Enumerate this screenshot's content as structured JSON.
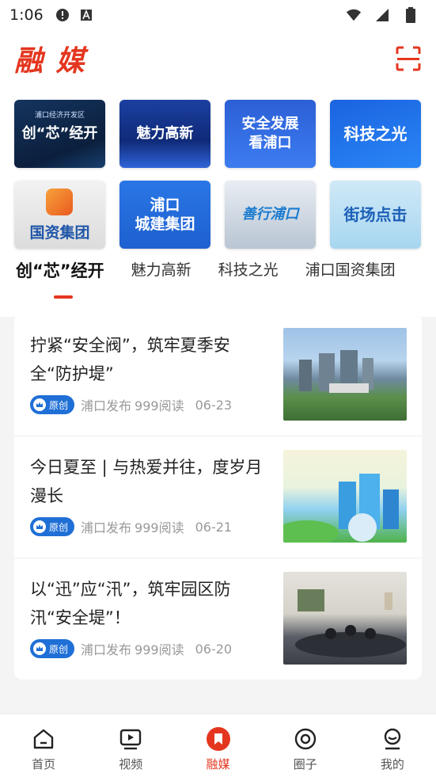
{
  "status_bar": {
    "time": "1:06",
    "icons": [
      "alert-icon",
      "a-badge-icon",
      "wifi-icon",
      "signal-icon",
      "battery-icon"
    ]
  },
  "header": {
    "title": "融 媒",
    "scan_icon": "scan-icon",
    "accent_color": "#e4361f"
  },
  "tiles": [
    {
      "label": "创“芯”经开",
      "sub": "浦口经济开发区"
    },
    {
      "label": "魅力高新",
      "sub": ""
    },
    {
      "label": "安全发展\n看浦口",
      "sub": ""
    },
    {
      "label": "科技之光",
      "sub": ""
    },
    {
      "label": "国资集团",
      "sub": ""
    },
    {
      "label": "浦口\n城建集团",
      "sub": ""
    },
    {
      "label": "善行浦口",
      "sub": ""
    },
    {
      "label": "街场点击",
      "sub": ""
    }
  ],
  "tabs": [
    {
      "label": "创“芯”经开",
      "active": true
    },
    {
      "label": "魅力高新",
      "active": false
    },
    {
      "label": "科技之光",
      "active": false
    },
    {
      "label": "浦口国资集团",
      "active": false
    }
  ],
  "news": [
    {
      "title": "拧紧“安全阀”，筑牢夏季安全“防护堤”",
      "badge": "原创",
      "source": "浦口发布",
      "reads": "999阅读",
      "date": "06-23"
    },
    {
      "title": "今日夏至 | 与热爱并往，度岁月漫长",
      "badge": "原创",
      "source": "浦口发布",
      "reads": "999阅读",
      "date": "06-21"
    },
    {
      "title": "以“迅”应“汛”，筑牢园区防汛“安全堤”！",
      "badge": "原创",
      "source": "浦口发布",
      "reads": "999阅读",
      "date": "06-20"
    }
  ],
  "bottom_nav": [
    {
      "label": "首页",
      "icon": "home-icon",
      "active": false
    },
    {
      "label": "视频",
      "icon": "video-icon",
      "active": false
    },
    {
      "label": "融媒",
      "icon": "bookmark-icon",
      "active": true
    },
    {
      "label": "圈子",
      "icon": "circle-icon",
      "active": false
    },
    {
      "label": "我的",
      "icon": "profile-icon",
      "active": false
    }
  ]
}
